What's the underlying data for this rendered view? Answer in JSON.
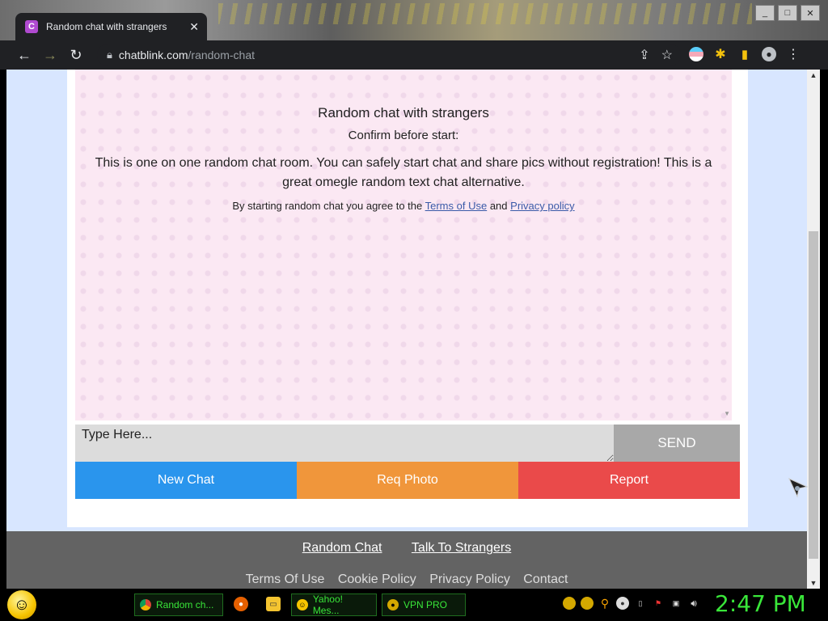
{
  "browser": {
    "tab_title": "Random chat with strangers",
    "tab_favicon_letter": "C",
    "url_host": "chatblink.com",
    "url_path": "/random-chat"
  },
  "page": {
    "chat_title": "Random chat with strangers",
    "confirm_text": "Confirm before start:",
    "description": "This is one on one random chat room. You can safely start chat and share pics without registration! This is a great omegle random text chat alternative.",
    "agree_prefix": "By starting random chat you agree to the",
    "terms_link": "Terms of Use",
    "agree_and": "and",
    "privacy_link": "Privacy policy",
    "input_placeholder": "Type Here...",
    "send_label": "SEND",
    "new_chat_label": "New Chat",
    "req_photo_label": "Req Photo",
    "report_label": "Report"
  },
  "footer": {
    "links_primary": [
      "Random Chat",
      "Talk To Strangers"
    ],
    "links_secondary": [
      "Terms Of Use",
      "Cookie Policy",
      "Privacy Policy",
      "Contact"
    ]
  },
  "taskbar": {
    "items": [
      {
        "label": "Random ch...",
        "icon": "chrome-icon"
      },
      {
        "label": "Yahoo! Mes...",
        "icon": "yahoo-messenger-icon"
      },
      {
        "label": "VPN PRO",
        "icon": "vpn-icon"
      }
    ],
    "clock": "2:47 PM"
  },
  "colors": {
    "new_chat": "#2a95ed",
    "req_photo": "#f0963b",
    "report": "#ea4a4a",
    "send": "#a8a8a8",
    "clock": "#39e639"
  }
}
